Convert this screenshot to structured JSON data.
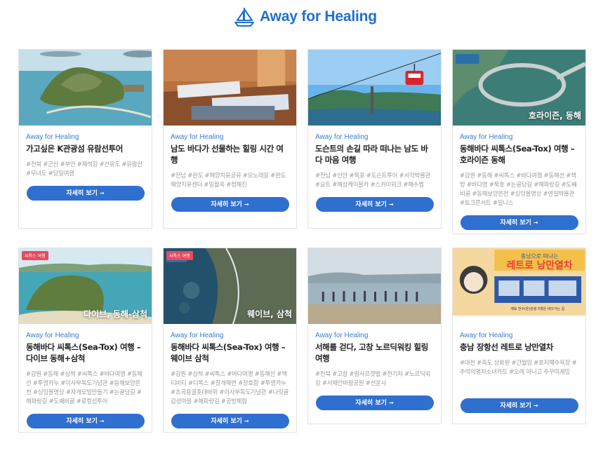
{
  "header": {
    "title": "Away for Healing",
    "logo_icon": "sailboat-icon"
  },
  "cards": [
    {
      "brand": "Away for Healing",
      "title": "가고싶은 K관광섬 유람선투어",
      "tags": "#전북 #군산 #부안 #채석강 #선유도 #유람선 #무녀도 #당일여행",
      "button": "자세히 보기",
      "arrow": "→"
    },
    {
      "brand": "Away for Healing",
      "title": "남도 바다가 선물하는 힐링 시간 여행",
      "tags": "#전남 #완도 #해양치유공유 #모노레일 #완도해양치유센터 #일월옥 #청해진",
      "button": "자세히 보기",
      "arrow": "→"
    },
    {
      "brand": "Away for Healing",
      "title": "도슨트의 손길 따라 떠나는 남도 바다 마음 여행",
      "tags": "#전남 #신안 #목포 #도슨트투어 #서각박물관 #요트 #해상케이블카 #스카이워크 #해수찜",
      "button": "자세히 보기",
      "arrow": "→"
    },
    {
      "brand": "Away for Healing",
      "title": "동해바다 씨톡스(Sea-Tox) 여행 – 호라이즌 동해",
      "tags": "#강원 #동해 #씨톡스 #바다여행 #동해선 #책방 #바다명 #묵호 #논골담길 #해파랑길 #도째비골 #동해보양온천 #싱잉볼명상 #연필박물관 #토크콘서트 #필니스",
      "overlay": "호라이즌, 동해",
      "button": "자세히 보기",
      "arrow": "→"
    },
    {
      "brand": "Away for Healing",
      "title": "동해바다 씨톡스(Sea-Tox) 여행 – 다이브 동해+삼척",
      "tags": "#강원 #동해 #삼척 #씨톡스 #바다여행 #동해선 #투명카누 #이사부독도기념관 #동해보양온천 #싱잉볼명상 #자개모빌만들기 #논골담길 #해파랑길 #도째비골 #로컬섬투어",
      "overlay": "다이브, 동해-삼척",
      "badge": "씨톡스 여행",
      "button": "자세히 보기",
      "arrow": "→"
    },
    {
      "brand": "Away for Healing",
      "title": "동해바다 씨톡스(Sea-Tox) 여행 – 웨이브 삼척",
      "tags": "#강원 #삼척 #씨톡스 #바다여행 #동해선 #액티비티 #디톡스 #장개해변 #장호항 #투명카누 #초곡용굴촛대바위 #이사부독도기념관 #나릿골감성마을 #해파랑길 #공방체험",
      "overlay": "웨이브, 삼척",
      "badge": "씨톡스 여행",
      "button": "자세히 보기",
      "arrow": "→"
    },
    {
      "brand": "Away for Healing",
      "title": "서해를 걷다, 고창 노르딕워킹 힐링 여행",
      "tags": "#전북 #고창 #람사르갯벌 #전기차 #노르딕워킹 #서해안바람공원 #선운사",
      "button": "자세히 보기",
      "arrow": "→"
    },
    {
      "brand": "Away for Healing",
      "title": "충남 장항선 레트로 낭만열차",
      "tags": "#대천 #축도 상화원 #간월암 #호지해수욕장 #추억의열차소녀카트 #오래 아니고 주꾸미게임",
      "poster_title": "레트로 낭만열차",
      "poster_sub": "충남으로 떠나는",
      "poster_line": "계묘 천수(온)관광 5월은 바다가는 길",
      "button": "자세히 보기",
      "arrow": "→"
    }
  ]
}
